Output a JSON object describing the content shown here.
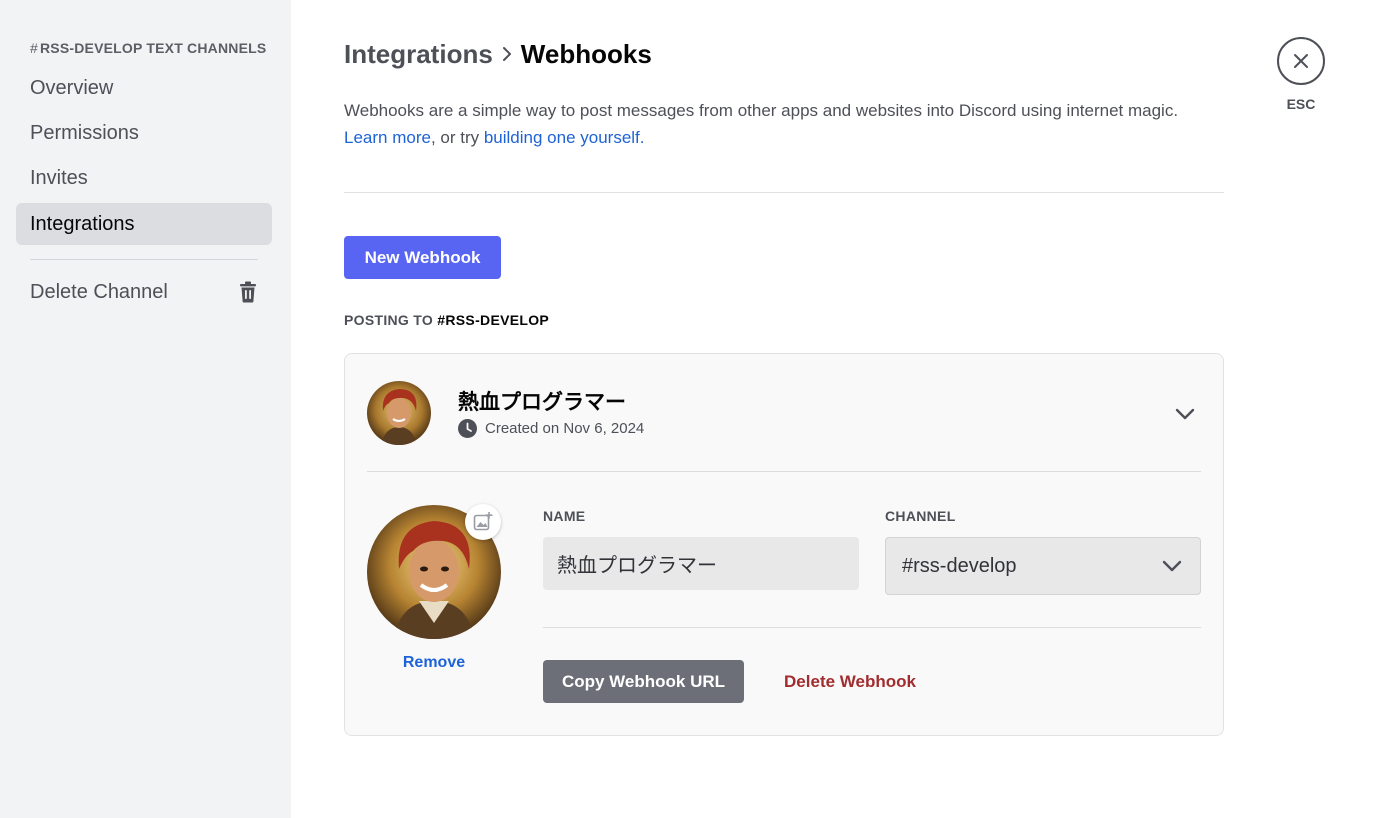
{
  "sidebar": {
    "header_hash": "#",
    "header": "RSS-DEVELOP TEXT CHANNELS",
    "items": [
      {
        "label": "Overview"
      },
      {
        "label": "Permissions"
      },
      {
        "label": "Invites"
      },
      {
        "label": "Integrations",
        "active": true
      }
    ],
    "delete_label": "Delete Channel",
    "icon": "trash-icon"
  },
  "header": {
    "breadcrumb_parent": "Integrations",
    "breadcrumb_current": "Webhooks",
    "separator_icon": "chevron-right-icon"
  },
  "description": {
    "text": "Webhooks are a simple way to post messages from other apps and websites into Discord using internet magic.",
    "learn_more": "Learn more",
    "or_try": ", or try ",
    "build_link": "building one yourself."
  },
  "new_webhook_label": "New Webhook",
  "posting_to": {
    "prefix": "POSTING TO",
    "channel": "#RSS-DEVELOP"
  },
  "webhook": {
    "name": "熱血プログラマー",
    "created": "Created on Nov 6, 2024",
    "name_label": "NAME",
    "channel_label": "CHANNEL",
    "name_value": "熱血プログラマー",
    "channel_value": "#rss-develop",
    "remove_label": "Remove",
    "copy_url_label": "Copy Webhook URL",
    "delete_label": "Delete Webhook"
  },
  "close": {
    "label": "ESC",
    "icon": "close-icon"
  },
  "colors": {
    "brand": "#5865f2",
    "link": "#1e63d6",
    "danger": "#a12d2f",
    "sidebar_bg": "#f2f3f5"
  }
}
